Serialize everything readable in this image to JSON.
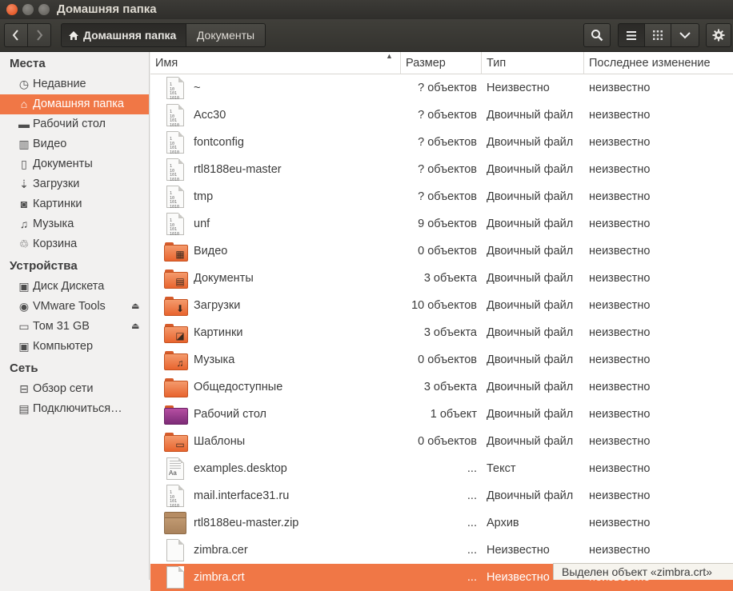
{
  "window": {
    "title": "Домашняя папка"
  },
  "toolbar": {
    "back_icon": "‹",
    "forward_icon": "›",
    "breadcrumb": [
      {
        "label": "Домашняя папка",
        "icon": "home-icon"
      },
      {
        "label": "Документы"
      }
    ],
    "search_icon": "search-icon",
    "list_view_icon": "list-view-icon",
    "grid_view_icon": "grid-view-icon",
    "menu_icon": "chevron-down-icon",
    "settings_icon": "gear-icon"
  },
  "sidebar": {
    "sections": [
      {
        "title": "Места",
        "items": [
          {
            "label": "Недавние",
            "icon": "clock-icon"
          },
          {
            "label": "Домашняя папка",
            "icon": "home-icon",
            "active": true
          },
          {
            "label": "Рабочий стол",
            "icon": "desktop-icon"
          },
          {
            "label": "Видео",
            "icon": "film-icon"
          },
          {
            "label": "Документы",
            "icon": "document-icon"
          },
          {
            "label": "Загрузки",
            "icon": "download-icon"
          },
          {
            "label": "Картинки",
            "icon": "camera-icon"
          },
          {
            "label": "Музыка",
            "icon": "music-icon"
          },
          {
            "label": "Корзина",
            "icon": "trash-icon"
          }
        ]
      },
      {
        "title": "Устройства",
        "items": [
          {
            "label": "Диск Дискета",
            "icon": "floppy-icon"
          },
          {
            "label": "VMware Tools",
            "icon": "disc-icon",
            "eject": true
          },
          {
            "label": "Том 31 GB",
            "icon": "drive-icon",
            "eject": true
          },
          {
            "label": "Компьютер",
            "icon": "computer-icon"
          }
        ]
      },
      {
        "title": "Сеть",
        "items": [
          {
            "label": "Обзор сети",
            "icon": "network-icon"
          },
          {
            "label": "Подключиться…",
            "icon": "connect-icon"
          }
        ]
      }
    ]
  },
  "columns": {
    "name": "Имя",
    "size": "Размер",
    "type": "Тип",
    "modified": "Последнее изменение"
  },
  "files": [
    {
      "name": "~",
      "size": "? объектов",
      "type": "Неизвестно",
      "modified": "неизвестно",
      "icon": "binary-file-icon"
    },
    {
      "name": "Acc30",
      "size": "? объектов",
      "type": "Двоичный файл",
      "modified": "неизвестно",
      "icon": "binary-file-icon"
    },
    {
      "name": "fontconfig",
      "size": "? объектов",
      "type": "Двоичный файл",
      "modified": "неизвестно",
      "icon": "binary-file-icon"
    },
    {
      "name": "rtl8188eu-master",
      "size": "? объектов",
      "type": "Двоичный файл",
      "modified": "неизвестно",
      "icon": "binary-file-icon"
    },
    {
      "name": "tmp",
      "size": "? объектов",
      "type": "Двоичный файл",
      "modified": "неизвестно",
      "icon": "binary-file-icon"
    },
    {
      "name": "unf",
      "size": "9 объектов",
      "type": "Двоичный файл",
      "modified": "неизвестно",
      "icon": "binary-file-icon"
    },
    {
      "name": "Видео",
      "size": "0 объектов",
      "type": "Двоичный файл",
      "modified": "неизвестно",
      "icon": "video-folder-icon",
      "emblem": "▦"
    },
    {
      "name": "Документы",
      "size": "3 объекта",
      "type": "Двоичный файл",
      "modified": "неизвестно",
      "icon": "documents-folder-icon",
      "emblem": "▤"
    },
    {
      "name": "Загрузки",
      "size": "10 объектов",
      "type": "Двоичный файл",
      "modified": "неизвестно",
      "icon": "downloads-folder-icon",
      "emblem": "⬇"
    },
    {
      "name": "Картинки",
      "size": "3 объекта",
      "type": "Двоичный файл",
      "modified": "неизвестно",
      "icon": "pictures-folder-icon",
      "emblem": "◪"
    },
    {
      "name": "Музыка",
      "size": "0 объектов",
      "type": "Двоичный файл",
      "modified": "неизвестно",
      "icon": "music-folder-icon",
      "emblem": "♫"
    },
    {
      "name": "Общедоступные",
      "size": "3 объекта",
      "type": "Двоичный файл",
      "modified": "неизвестно",
      "icon": "public-folder-icon",
      "emblem": ""
    },
    {
      "name": "Рабочий стол",
      "size": "1 объект",
      "type": "Двоичный файл",
      "modified": "неизвестно",
      "icon": "desktop-folder-icon",
      "emblem": ""
    },
    {
      "name": "Шаблоны",
      "size": "0 объектов",
      "type": "Двоичный файл",
      "modified": "неизвестно",
      "icon": "templates-folder-icon",
      "emblem": "▭"
    },
    {
      "name": "examples.desktop",
      "size": "...",
      "type": "Текст",
      "modified": "неизвестно",
      "icon": "text-file-icon"
    },
    {
      "name": "mail.interface31.ru",
      "size": "...",
      "type": "Двоичный файл",
      "modified": "неизвестно",
      "icon": "binary-file-icon"
    },
    {
      "name": "rtl8188eu-master.zip",
      "size": "...",
      "type": "Архив",
      "modified": "неизвестно",
      "icon": "archive-icon"
    },
    {
      "name": "zimbra.cer",
      "size": "...",
      "type": "Неизвестно",
      "modified": "неизвестно",
      "icon": "generic-file-icon"
    },
    {
      "name": "zimbra.crt",
      "size": "...",
      "type": "Неизвестно",
      "modified": "неизвестно",
      "icon": "generic-file-icon",
      "selected": true
    }
  ],
  "status": {
    "text": "Выделен объект «zimbra.crt»"
  },
  "colors": {
    "accent": "#f07746",
    "titlebar": "#3c3b37",
    "folder": "#e8642e"
  }
}
